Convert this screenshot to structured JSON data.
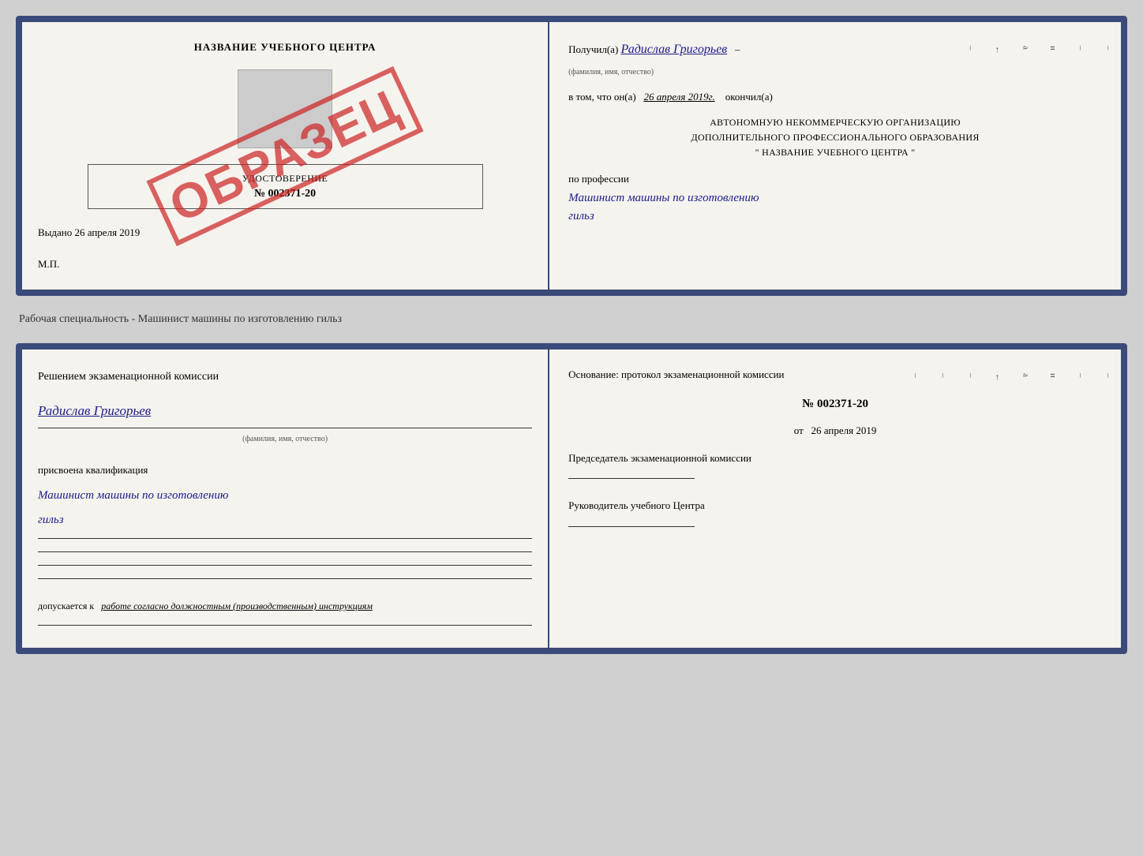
{
  "top_doc": {
    "left": {
      "center_title": "НАЗВАНИЕ УЧЕБНОГО ЦЕНТРА",
      "stamp_placeholder": "",
      "certificate_title": "УДОСТОВЕРЕНИЕ",
      "certificate_number": "№ 002371-20",
      "issued_label": "Выдано",
      "issued_date": "26 апреля 2019",
      "mp_label": "М.П.",
      "obrazec": "ОБРАЗЕЦ"
    },
    "right": {
      "received_label": "Получил(а)",
      "received_name": "Радислав Григорьев",
      "received_sublabel": "(фамилия, имя, отчество)",
      "date_prefix": "в том, что он(а)",
      "date_value": "26 апреля 2019г.",
      "date_suffix": "окончил(а)",
      "org_line1": "АВТОНОМНУЮ НЕКОММЕРЧЕСКУЮ ОРГАНИЗАЦИЮ",
      "org_line2": "ДОПОЛНИТЕЛЬНОГО ПРОФЕССИОНАЛЬНОГО ОБРАЗОВАНИЯ",
      "org_line3": "\"  НАЗВАНИЕ УЧЕБНОГО ЦЕНТРА  \"",
      "profession_label": "по профессии",
      "profession_value": "Машинист машины по изготовлению",
      "profession_value2": "гильз"
    }
  },
  "separator": {
    "text": "Рабочая специальность - Машинист машины по изготовлению гильз"
  },
  "bottom_doc": {
    "left": {
      "decision_text": "Решением  экзаменационной  комиссии",
      "person_name": "Радислав Григорьев",
      "person_sublabel": "(фамилия, имя, отчество)",
      "assigned_label": "присвоена квалификация",
      "qualification_value": "Машинист машины по изготовлению",
      "qualification_value2": "гильз",
      "допускается_prefix": "допускается к",
      "допускается_value": "работе согласно должностным (производственным) инструкциям"
    },
    "right": {
      "basis_text": "Основание: протокол экзаменационной  комиссии",
      "protocol_number": "№  002371-20",
      "date_prefix": "от",
      "date_value": "26 апреля 2019",
      "chairman_title": "Председатель экзаменационной комиссии",
      "director_title": "Руководитель учебного Центра"
    }
  }
}
